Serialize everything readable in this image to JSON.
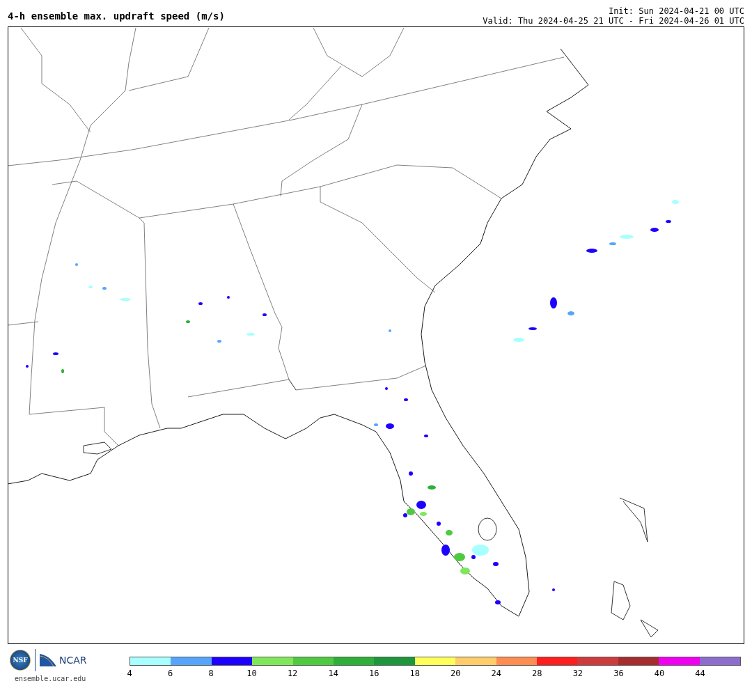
{
  "header": {
    "title": "4-h ensemble max. updraft speed (m/s)",
    "init": "Init: Sun 2024-04-21 00 UTC",
    "valid": "Valid: Thu 2024-04-25 21 UTC - Fri 2024-04-26 01 UTC"
  },
  "footer": {
    "nsf_logo_text": "NSF",
    "ncar_logo_text": "NCAR",
    "website": "ensemble.ucar.edu"
  },
  "legend": {
    "bins": [
      {
        "color": "#a8ffff"
      },
      {
        "color": "#55a5ff"
      },
      {
        "color": "#1e00ff"
      },
      {
        "color": "#80e65a"
      },
      {
        "color": "#4ec940"
      },
      {
        "color": "#2eaf38"
      },
      {
        "color": "#1e963c"
      },
      {
        "color": "#ffff5a"
      },
      {
        "color": "#ffcd69"
      },
      {
        "color": "#ff8c50"
      },
      {
        "color": "#ff1e1e"
      },
      {
        "color": "#cd3c3c"
      },
      {
        "color": "#a52d2d"
      },
      {
        "color": "#f000f0"
      },
      {
        "color": "#8c6ccc"
      }
    ],
    "ticks": [
      "4",
      "6",
      "8",
      "10",
      "12",
      "14",
      "16",
      "18",
      "20",
      "24",
      "28",
      "32",
      "36",
      "40",
      "44"
    ]
  }
}
